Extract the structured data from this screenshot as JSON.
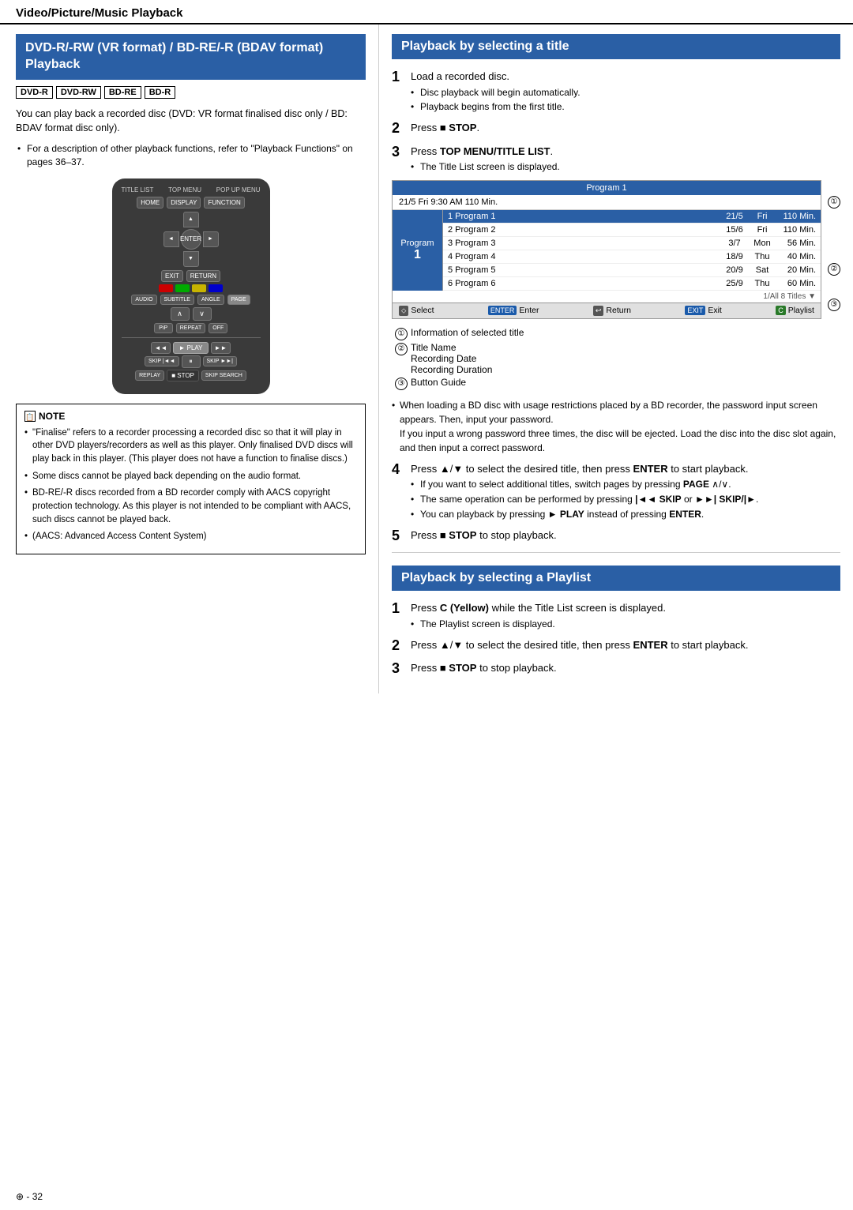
{
  "header": {
    "title": "Video/Picture/Music Playback"
  },
  "left": {
    "section_title": "DVD-R/-RW (VR format) / BD-RE/-R (BDAV format) Playback",
    "badges": [
      "DVD-R",
      "DVD-RW",
      "BD-RE",
      "BD-R"
    ],
    "intro": "You can play back a recorded disc (DVD: VR format finalised disc only / BD: BDAV format disc only).",
    "bullet": "For a description of other playback functions, refer to \"Playback Functions\" on pages 36–37.",
    "note_title": "NOTE",
    "notes": [
      "\"Finalise\" refers to a recorder processing a recorded disc so that it will play in other DVD players/recorders as well as this player. Only finalised DVD discs will play back in this player. (This player does not have a function to finalise discs.)",
      "Some discs cannot be played back depending on the audio format.",
      "BD-RE/-R discs recorded from a BD recorder comply with AACS copyright protection technology. As this player is not intended to be compliant with AACS, such discs cannot be played back.",
      "(AACS: Advanced Access Content System)"
    ]
  },
  "right": {
    "section1_title": "Playback by selecting a title",
    "steps": [
      {
        "num": "1",
        "text": "Load a recorded disc.",
        "subs": [
          "Disc playback will begin automatically.",
          "Playback begins from the first title."
        ]
      },
      {
        "num": "2",
        "text": "Press ■ STOP."
      },
      {
        "num": "3",
        "text": "Press TOP MENU/TITLE LIST.",
        "subs": [
          "The Title List screen is displayed."
        ]
      }
    ],
    "title_list_screen": {
      "header": "Program 1",
      "sub_header": "21/5   Fri   9:30 AM   110 Min.",
      "sidebar_label": "Program",
      "sidebar_num": "1",
      "rows": [
        {
          "name": "1 Program 1",
          "date": "21/5",
          "day": "Fri",
          "dur": "110 Min.",
          "highlight": true
        },
        {
          "name": "2 Program 2",
          "date": "15/6",
          "day": "Fri",
          "dur": "110 Min.",
          "highlight": false
        },
        {
          "name": "3 Program 3",
          "date": "3/7",
          "day": "Mon",
          "dur": "56 Min.",
          "highlight": false
        },
        {
          "name": "4 Program 4",
          "date": "18/9",
          "day": "Thu",
          "dur": "40 Min.",
          "highlight": false
        },
        {
          "name": "5 Program 5",
          "date": "20/9",
          "day": "Sat",
          "dur": "20 Min.",
          "highlight": false
        },
        {
          "name": "6 Program 6",
          "date": "25/9",
          "day": "Thu",
          "dur": "60 Min.",
          "highlight": false
        }
      ],
      "footer": "1/All 8 Titles ▼",
      "controls": [
        {
          "icon": "⬦",
          "label": "Select",
          "color": ""
        },
        {
          "icon": "ENTER",
          "label": "Enter",
          "color": "blue"
        },
        {
          "icon": "↩",
          "label": "Return",
          "color": ""
        },
        {
          "icon": "EXIT",
          "label": "Exit",
          "color": "blue"
        },
        {
          "icon": "C",
          "label": "Playlist",
          "color": "green"
        }
      ]
    },
    "annotations": [
      {
        "num": "①",
        "label": "Information of selected title"
      },
      {
        "num": "②",
        "lines": [
          "Title Name",
          "Recording Date",
          "Recording Duration"
        ]
      },
      {
        "num": "③",
        "label": "Button Guide"
      }
    ],
    "note_bd": "When loading a BD disc with usage restrictions placed by a BD recorder, the password input screen appears. Then, input your password.\nIf you input a wrong password three times, the disc will be ejected. Load the disc into the disc slot again, and then input a correct password.",
    "steps2": [
      {
        "num": "4",
        "text": "Press ▲/▼ to select the desired title, then press ENTER to start playback.",
        "subs": [
          "If you want to select additional titles, switch pages by pressing PAGE ∧/∨.",
          "The same operation can be performed by pressing |◄◄ SKIP or ►►| SKIP/|►.",
          "You can playback by pressing ► PLAY instead of pressing ENTER."
        ]
      },
      {
        "num": "5",
        "text": "Press ■ STOP to stop playback."
      }
    ],
    "section2_title": "Playback by selecting a Playlist",
    "playlist_steps": [
      {
        "num": "1",
        "text": "Press C (Yellow) while the Title List screen is displayed.",
        "subs": [
          "The Playlist screen is displayed."
        ]
      },
      {
        "num": "2",
        "text": "Press ▲/▼ to select the desired title, then press ENTER to start playback."
      },
      {
        "num": "3",
        "text": "Press ■ STOP to stop playback."
      }
    ]
  },
  "footer": {
    "page": "32"
  }
}
